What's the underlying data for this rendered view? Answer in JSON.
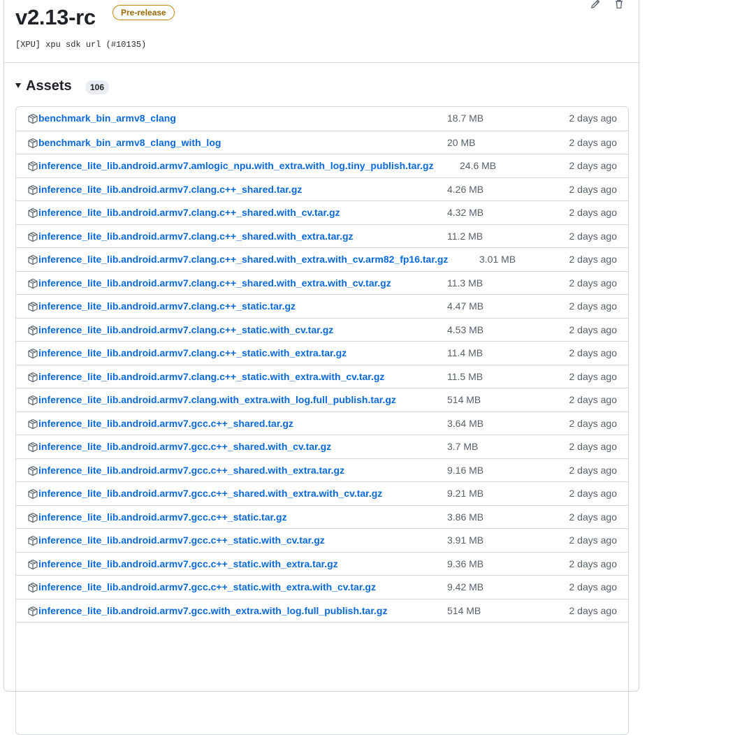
{
  "release": {
    "title": "v2.13-rc",
    "badge": "Pre-release",
    "commit_message": "[XPU] xpu sdk url (#10135)"
  },
  "assets": {
    "title": "Assets",
    "count": "106",
    "items": [
      {
        "name": "benchmark_bin_armv8_clang",
        "size": "18.7 MB",
        "date": "2 days ago"
      },
      {
        "name": "benchmark_bin_armv8_clang_with_log",
        "size": "20 MB",
        "date": "2 days ago"
      },
      {
        "name": "inference_lite_lib.android.armv7.amlogic_npu.with_extra.with_log.tiny_publish.tar.gz",
        "size": "24.6 MB",
        "date": "2 days ago"
      },
      {
        "name": "inference_lite_lib.android.armv7.clang.c++_shared.tar.gz",
        "size": "4.26 MB",
        "date": "2 days ago"
      },
      {
        "name": "inference_lite_lib.android.armv7.clang.c++_shared.with_cv.tar.gz",
        "size": "4.32 MB",
        "date": "2 days ago"
      },
      {
        "name": "inference_lite_lib.android.armv7.clang.c++_shared.with_extra.tar.gz",
        "size": "11.2 MB",
        "date": "2 days ago"
      },
      {
        "name": "inference_lite_lib.android.armv7.clang.c++_shared.with_extra.with_cv.arm82_fp16.tar.gz",
        "size": "3.01 MB",
        "date": "2 days ago"
      },
      {
        "name": "inference_lite_lib.android.armv7.clang.c++_shared.with_extra.with_cv.tar.gz",
        "size": "11.3 MB",
        "date": "2 days ago"
      },
      {
        "name": "inference_lite_lib.android.armv7.clang.c++_static.tar.gz",
        "size": "4.47 MB",
        "date": "2 days ago"
      },
      {
        "name": "inference_lite_lib.android.armv7.clang.c++_static.with_cv.tar.gz",
        "size": "4.53 MB",
        "date": "2 days ago"
      },
      {
        "name": "inference_lite_lib.android.armv7.clang.c++_static.with_extra.tar.gz",
        "size": "11.4 MB",
        "date": "2 days ago"
      },
      {
        "name": "inference_lite_lib.android.armv7.clang.c++_static.with_extra.with_cv.tar.gz",
        "size": "11.5 MB",
        "date": "2 days ago"
      },
      {
        "name": "inference_lite_lib.android.armv7.clang.with_extra.with_log.full_publish.tar.gz",
        "size": "514 MB",
        "date": "2 days ago"
      },
      {
        "name": "inference_lite_lib.android.armv7.gcc.c++_shared.tar.gz",
        "size": "3.64 MB",
        "date": "2 days ago"
      },
      {
        "name": "inference_lite_lib.android.armv7.gcc.c++_shared.with_cv.tar.gz",
        "size": "3.7 MB",
        "date": "2 days ago"
      },
      {
        "name": "inference_lite_lib.android.armv7.gcc.c++_shared.with_extra.tar.gz",
        "size": "9.16 MB",
        "date": "2 days ago"
      },
      {
        "name": "inference_lite_lib.android.armv7.gcc.c++_shared.with_extra.with_cv.tar.gz",
        "size": "9.21 MB",
        "date": "2 days ago"
      },
      {
        "name": "inference_lite_lib.android.armv7.gcc.c++_static.tar.gz",
        "size": "3.86 MB",
        "date": "2 days ago"
      },
      {
        "name": "inference_lite_lib.android.armv7.gcc.c++_static.with_cv.tar.gz",
        "size": "3.91 MB",
        "date": "2 days ago"
      },
      {
        "name": "inference_lite_lib.android.armv7.gcc.c++_static.with_extra.tar.gz",
        "size": "9.36 MB",
        "date": "2 days ago"
      },
      {
        "name": "inference_lite_lib.android.armv7.gcc.c++_static.with_extra.with_cv.tar.gz",
        "size": "9.42 MB",
        "date": "2 days ago"
      },
      {
        "name": "inference_lite_lib.android.armv7.gcc.with_extra.with_log.full_publish.tar.gz",
        "size": "514 MB",
        "date": "2 days ago"
      },
      {
        "name": "",
        "size": "",
        "date": ""
      }
    ]
  },
  "icons": {
    "edit": "pencil-icon",
    "delete": "trash-icon",
    "asset": "package-icon",
    "toggle": "triangle-down-icon"
  },
  "colors": {
    "link": "#0969da",
    "badge_border": "#bf8700",
    "badge_text": "#9a6700",
    "muted": "#57606a",
    "border": "#d0d7de"
  }
}
